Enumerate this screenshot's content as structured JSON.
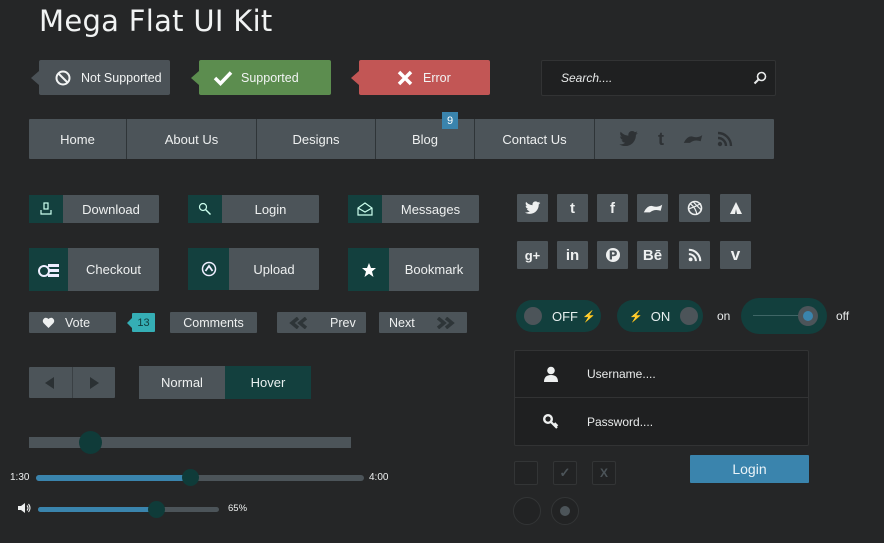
{
  "title": "Mega Flat UI Kit",
  "tags": {
    "not_supported": "Not Supported",
    "supported": "Supported",
    "error": "Error"
  },
  "search": {
    "placeholder": "Search...."
  },
  "nav": {
    "items": [
      {
        "label": "Home"
      },
      {
        "label": "About Us"
      },
      {
        "label": "Designs"
      },
      {
        "label": "Blog",
        "badge": "9"
      },
      {
        "label": "Contact Us"
      }
    ],
    "social_icons": [
      "twitter-icon",
      "tumblr-icon",
      "deviantart-icon",
      "rss-icon"
    ]
  },
  "buttons": {
    "download": "Download",
    "login": "Login",
    "messages": "Messages",
    "checkout": "Checkout",
    "upload": "Upload",
    "bookmark": "Bookmark",
    "vote": "Vote",
    "vote_count": "13",
    "comments": "Comments",
    "prev": "Prev",
    "next": "Next",
    "normal": "Normal",
    "hover": "Hover"
  },
  "player": {
    "current_time": "1:30",
    "total_time": "4:00",
    "progress_fraction": 0.47,
    "volume_label": "65%",
    "volume_fraction": 0.65
  },
  "slider_fraction": 0.19,
  "social_grid": [
    [
      "twitter-icon",
      "tumblr-icon",
      "facebook-icon",
      "deviantart-icon",
      "dribbble-icon",
      "tent-icon"
    ],
    [
      "googleplus-icon",
      "linkedin-icon",
      "pinterest-icon",
      "behance-icon",
      "rss-icon",
      "vimeo-icon"
    ]
  ],
  "social_glyphs": {
    "tumblr": "t",
    "facebook": "f",
    "googleplus": "g+",
    "linkedin": "in",
    "pinterest": "P",
    "behance": "Bē",
    "vimeo": "v"
  },
  "toggles": {
    "off_label": "OFF",
    "on_label": "ON",
    "switch_on": "on",
    "switch_off": "off"
  },
  "login_form": {
    "username_placeholder": "Username....",
    "password_placeholder": "Password....",
    "submit": "Login"
  },
  "checkboxes": {
    "check_mark": "✓",
    "x_mark": "X"
  },
  "colors": {
    "background": "#252627",
    "panel": "#4c5459",
    "accent_dark": "#13403e",
    "accent_blue": "#3a84ad",
    "success": "#5c8d4f",
    "error": "#c25655",
    "teal_badge": "#35aeb5"
  }
}
